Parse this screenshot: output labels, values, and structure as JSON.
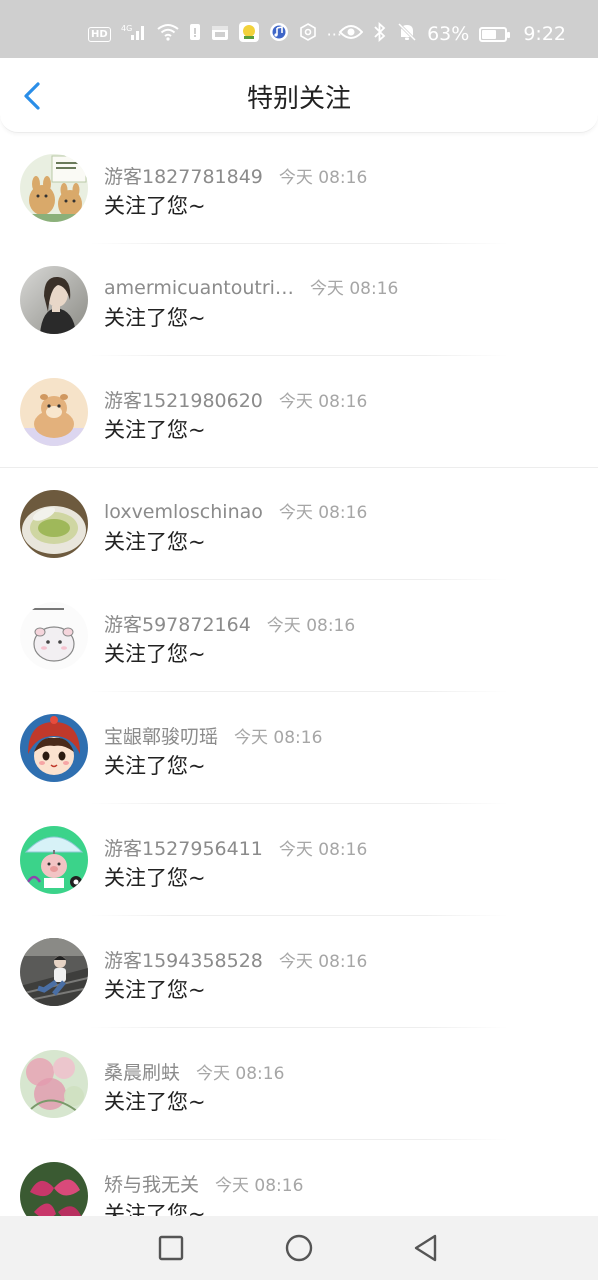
{
  "status_bar": {
    "left_icons": [
      "hd-icon",
      "4g-signal-icon",
      "wifi-icon",
      "sim-icon",
      "calendar-icon",
      "app-icon",
      "music-icon",
      "settings-icon",
      "more-icon"
    ],
    "more": "···",
    "battery_percent": "63%",
    "battery_level": 0.63,
    "time": "9:22"
  },
  "header": {
    "title": "特别关注",
    "back_icon": "chevron-left-icon",
    "accent": "#2a8ee8"
  },
  "items": [
    {
      "name": "游客1827781849",
      "time": "今天 08:16",
      "message": "关注了您~",
      "avatar": "cartoon-pets"
    },
    {
      "name": "amermicuantoutri…",
      "time": "今天 08:16",
      "message": "关注了您~",
      "avatar": "girl-photo"
    },
    {
      "name": "游客1521980620",
      "time": "今天 08:16",
      "message": "关注了您~",
      "avatar": "hamster-cartoon"
    },
    {
      "name": "loxvemloschinao",
      "time": "今天 08:16",
      "message": "关注了您~",
      "avatar": "soup-bowl"
    },
    {
      "name": "游客597872164",
      "time": "今天 08:16",
      "message": "关注了您~",
      "avatar": "hamster-sketch"
    },
    {
      "name": "宝龈鄣骏叨瑶",
      "time": "今天 08:16",
      "message": "关注了您~",
      "avatar": "cartoon-girl"
    },
    {
      "name": "游客1527956411",
      "time": "今天 08:16",
      "message": "关注了您~",
      "avatar": "pig-umbrella"
    },
    {
      "name": "游客1594358528",
      "time": "今天 08:16",
      "message": "关注了您~",
      "avatar": "boy-stairs"
    },
    {
      "name": "桑晨刷蚨",
      "time": "今天 08:16",
      "message": "关注了您~",
      "avatar": "pink-flowers"
    },
    {
      "name": "矫与我无关",
      "time": "今天 08:16",
      "message": "关注了您~",
      "avatar": "red-leaves"
    }
  ],
  "nav_bar": {
    "icons": [
      "recent-apps-square-icon",
      "home-circle-icon",
      "back-triangle-icon"
    ]
  }
}
